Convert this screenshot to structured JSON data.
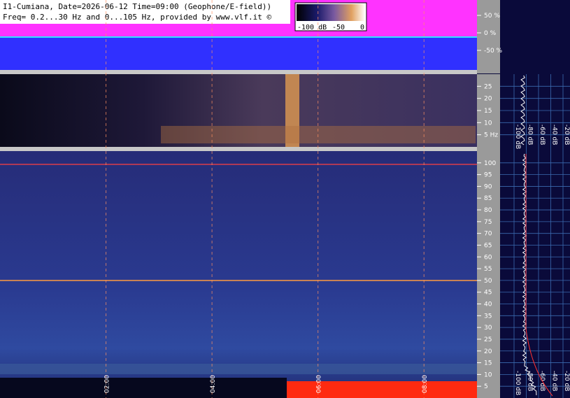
{
  "header": {
    "line1": "I1-Cumiana, Date=2026-06-12 Time=09:00 (Geophone/E-field))",
    "line2": "Freq= 0.2...30 Hz and 0...105 Hz, provided by www.vlf.it ©"
  },
  "colorbar": {
    "labels": [
      "-100 dB",
      "-50",
      "0"
    ]
  },
  "chart_data": [
    {
      "type": "area",
      "panel": "amplitude",
      "y_tick_labels": [
        "50 %",
        "0 %",
        "-50 %"
      ],
      "y_values": [
        50,
        0,
        -50
      ],
      "colors": {
        "envelope": "#ff33ff",
        "background": "#3030ff",
        "signal": "#33e0ff"
      }
    },
    {
      "type": "heatmap",
      "panel": "geophone-spectrogram",
      "y_tick_labels": [
        "25",
        "20",
        "15",
        "10",
        "5 Hz"
      ],
      "y_values": [
        25,
        20,
        15,
        10,
        5
      ],
      "ylim": [
        0,
        30
      ],
      "x_tick_labels": [
        "02:00",
        "04:00",
        "06:00",
        "08:00"
      ],
      "x_values": [
        "02:00",
        "04:00",
        "06:00",
        "08:00"
      ]
    },
    {
      "type": "heatmap",
      "panel": "efield-spectrogram",
      "y_tick_labels": [
        "100",
        "95",
        "90",
        "85",
        "80",
        "75",
        "70",
        "65",
        "60",
        "55",
        "50",
        "45",
        "40",
        "35",
        "30",
        "25",
        "20",
        "15",
        "10",
        "5"
      ],
      "y_values": [
        100,
        95,
        90,
        85,
        80,
        75,
        70,
        65,
        60,
        55,
        50,
        45,
        40,
        35,
        30,
        25,
        20,
        15,
        10,
        5
      ],
      "ylim": [
        0,
        105
      ],
      "x_tick_labels": [
        "02:00",
        "04:00",
        "06:00",
        "08:00"
      ],
      "x_values": [
        "02:00",
        "04:00",
        "06:00",
        "08:00"
      ],
      "markers_hz": [
        100,
        50
      ]
    },
    {
      "type": "line",
      "panel": "geophone-spectrum-profile",
      "x_tick_labels": [
        "-100 dB",
        "-80 dB",
        "-60 dB",
        "-40 dB",
        "-20 dB"
      ],
      "x_values": [
        -100,
        -80,
        -60,
        -40,
        -20
      ]
    },
    {
      "type": "line",
      "panel": "efield-spectrum-profile",
      "x_tick_labels": [
        "-100 dB",
        "-80 dB",
        "-60 dB",
        "-40 dB",
        "-20 dB"
      ],
      "x_values": [
        -100,
        -80,
        -60,
        -40,
        -20
      ]
    }
  ]
}
